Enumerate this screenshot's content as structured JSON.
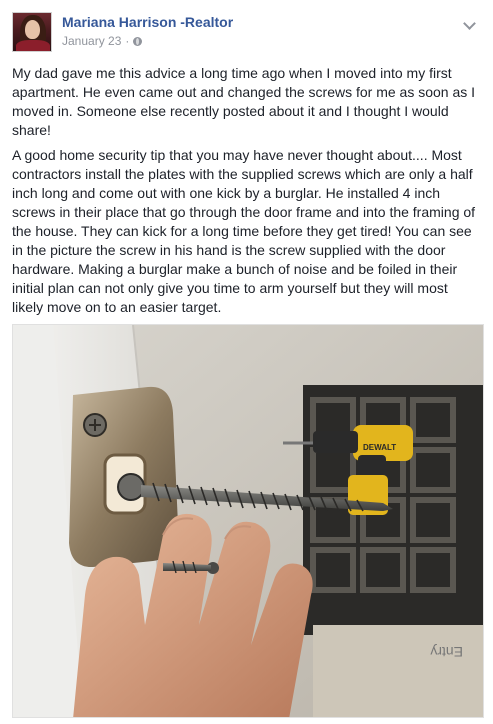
{
  "post": {
    "author": "Mariana Harrison -Realtor",
    "date": "January 23",
    "separator": "·",
    "privacy_icon": "globe-icon",
    "menu_icon": "chevron-down-icon",
    "paragraphs": [
      "My dad gave me this advice a long time ago when I moved into my first apartment. He even came out and changed the screws for me as soon as I moved in. Someone else recently posted about it and I thought I would share!",
      "A good home security tip that you may have never thought about.... Most contractors install the plates with the supplied screws which are only a half inch long and come out with one kick by a burglar. He installed 4 inch screws in their place that go through the door frame and into the framing of the house. They can kick for a long time before they get tired! You can see in the picture the screw in his hand is the screw supplied with the door hardware. Making a burglar make a bunch of noise and be foiled in their initial plan can not only give you time to arm yourself but they will most likely move on to an easier target."
    ]
  },
  "photo": {
    "drill_label": "DEWALT",
    "mat_label": "Entry"
  },
  "colors": {
    "author_link": "#365899",
    "meta_gray": "#90949c",
    "text": "#1d2129"
  }
}
